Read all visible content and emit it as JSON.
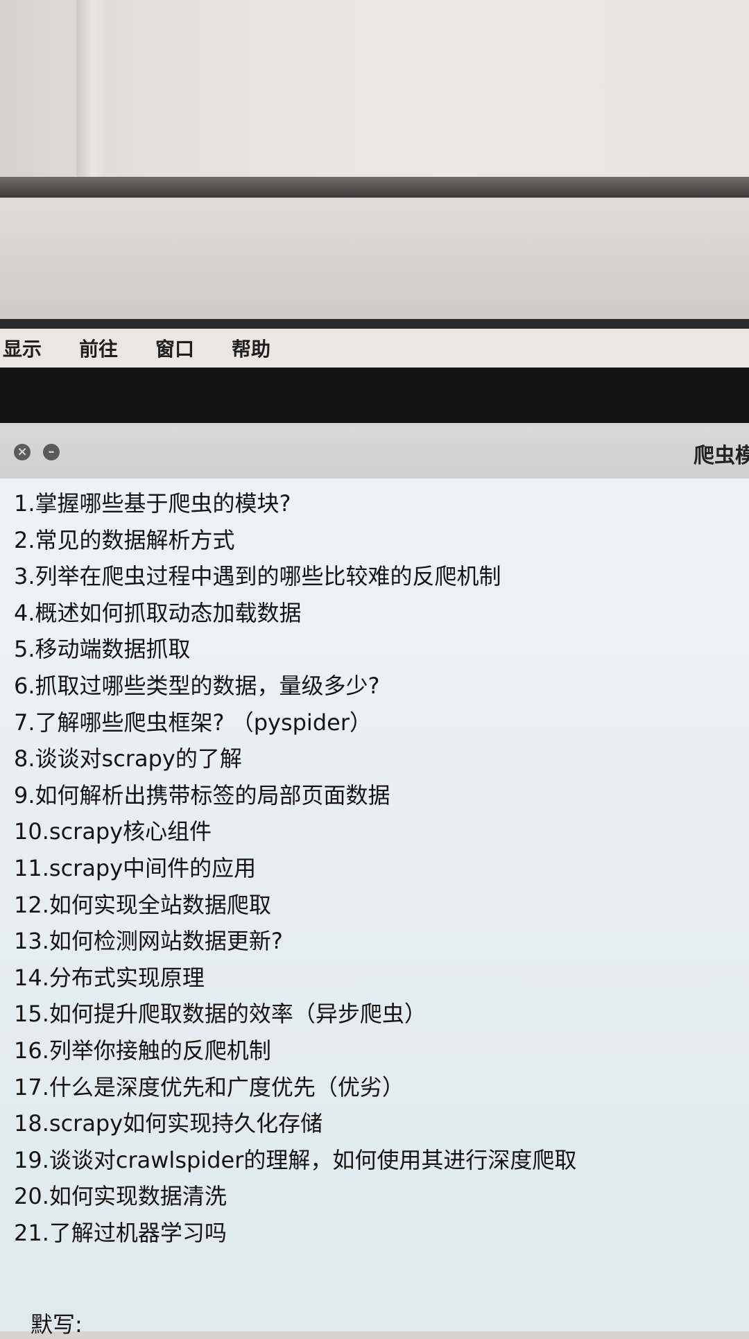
{
  "menubar": {
    "items": [
      "显示",
      "前往",
      "窗口",
      "帮助"
    ]
  },
  "window": {
    "title": "爬虫模"
  },
  "questions": [
    "1.掌握哪些基于爬虫的模块?",
    "2.常见的数据解析方式",
    "3.列举在爬虫过程中遇到的哪些比较难的反爬机制",
    "4.概述如何抓取动态加载数据",
    "5.移动端数据抓取",
    "6.抓取过哪些类型的数据，量级多少?",
    "7.了解哪些爬虫框架? （pyspider）",
    "8.谈谈对scrapy的了解",
    "9.如何解析出携带标签的局部页面数据",
    "10.scrapy核心组件",
    "11.scrapy中间件的应用",
    "12.如何实现全站数据爬取",
    "13.如何检测网站数据更新?",
    "14.分布式实现原理",
    "15.如何提升爬取数据的效率（异步爬虫）",
    "16.列举你接触的反爬机制",
    "17.什么是深度优先和广度优先（优劣）",
    "18.scrapy如何实现持久化存储",
    "19.谈谈对crawlspider的理解，如何使用其进行深度爬取",
    "20.如何实现数据清洗",
    "21.了解过机器学习吗"
  ],
  "footer": {
    "label": "默写:"
  },
  "colors": {
    "menubar_bg": "#e9e6e3",
    "window_content_bg": "#e7eef1",
    "text": "#141414"
  }
}
